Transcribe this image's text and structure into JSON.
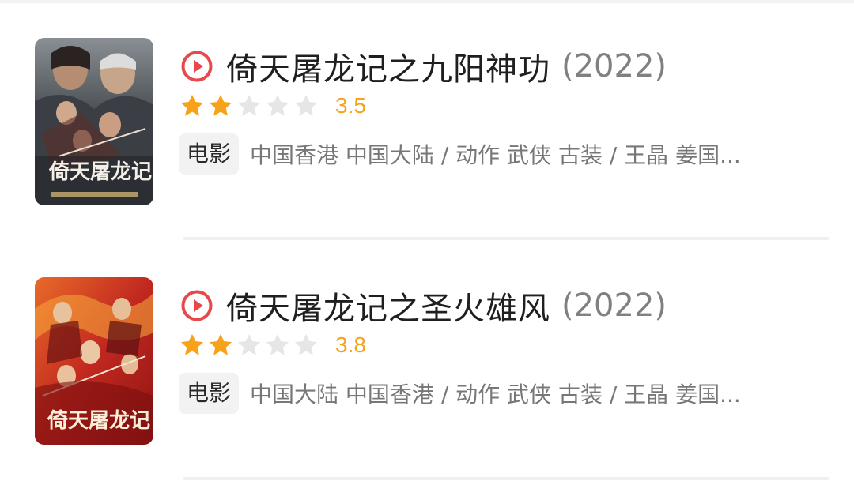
{
  "results": [
    {
      "title": "倚天屠龙记之九阳神功",
      "year": "(2022)",
      "rating": 3.5,
      "rating_label": "3.5",
      "stars_filled": 2,
      "stars_total": 5,
      "type": "电影",
      "meta": "中国香港 中国大陆 / 动作 武侠 古装 / 王晶 姜国...",
      "poster_icon": "movie-poster"
    },
    {
      "title": "倚天屠龙记之圣火雄风",
      "year": "(2022)",
      "rating": 3.8,
      "rating_label": "3.8",
      "stars_filled": 2,
      "stars_total": 5,
      "type": "电影",
      "meta": "中国大陆 中国香港 / 动作 武侠 古装 / 王晶 姜国...",
      "poster_icon": "movie-poster"
    }
  ],
  "colors": {
    "play_icon": "#e8484a",
    "star_filled": "#f7a21b",
    "star_empty": "#e6e6e6",
    "score": "#f7a21b",
    "title": "#1f1f1f",
    "year": "#808080",
    "meta": "#777777",
    "tag_bg": "#f2f2f2"
  }
}
